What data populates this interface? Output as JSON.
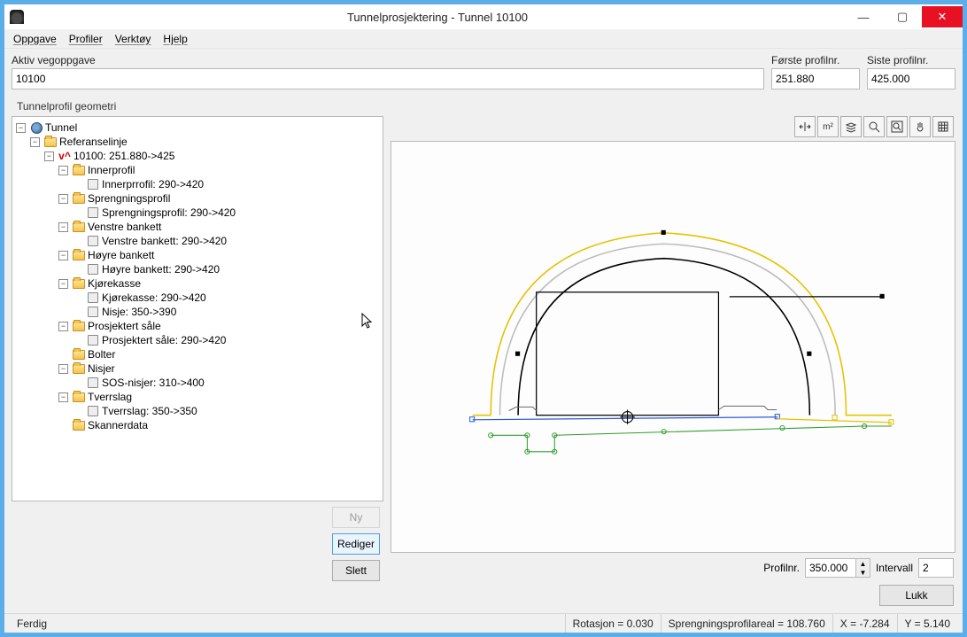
{
  "title": "Tunnelprosjektering - Tunnel 10100",
  "menu": {
    "oppgave": "Oppgave",
    "profiler": "Profiler",
    "verktoy": "Verktøy",
    "hjelp": "Hjelp"
  },
  "fields": {
    "aktiv_label": "Aktiv vegoppgave",
    "aktiv_value": "10100",
    "forste_label": "Første profilnr.",
    "forste_value": "251.880",
    "siste_label": "Siste profilnr.",
    "siste_value": "425.000"
  },
  "subtitle": "Tunnelprofil geometri",
  "tree": {
    "root": "Tunnel",
    "ref": "Referanselinje",
    "line": "10100: 251.880->425",
    "innerprofil_folder": "Innerprofil",
    "innerprofil_item": "Innerprrofil: 290->420",
    "spreng_folder": "Sprengningsprofil",
    "spreng_item": "Sprengningsprofil: 290->420",
    "venstre_folder": "Venstre bankett",
    "venstre_item": "Venstre bankett: 290->420",
    "hoyre_folder": "Høyre bankett",
    "hoyre_item": "Høyre bankett: 290->420",
    "kjorekasse_folder": "Kjørekasse",
    "kjorekasse_item": "Kjørekasse: 290->420",
    "nisje_item": "Nisje: 350->390",
    "sale_folder": "Prosjektert såle",
    "sale_item": "Prosjektert såle: 290->420",
    "bolter": "Bolter",
    "nisjer_folder": "Nisjer",
    "sos_item": "SOS-nisjer: 310->400",
    "tverrslag_folder": "Tverrslag",
    "tverrslag_item": "Tverrslag: 350->350",
    "skannerdata": "Skannerdata"
  },
  "buttons": {
    "ny": "Ny",
    "rediger": "Rediger",
    "slett": "Slett",
    "lukk": "Lukk"
  },
  "bottom": {
    "profilnr_label": "Profilnr.",
    "profilnr_value": "350.000",
    "intervall_label": "Intervall",
    "intervall_value": "2"
  },
  "status": {
    "ready": "Ferdig",
    "rotasjon": "Rotasjon = 0.030",
    "areal": "Sprengningsprofilareal = 108.760",
    "x": "X = -7.284",
    "y": "Y = 5.140"
  },
  "toolbar_icons": {
    "fit_width": "fit-width",
    "area": "m²",
    "layers": "layers",
    "zoom": "zoom",
    "zoom_extents": "zoom-extents",
    "pan": "pan",
    "grid": "grid"
  }
}
